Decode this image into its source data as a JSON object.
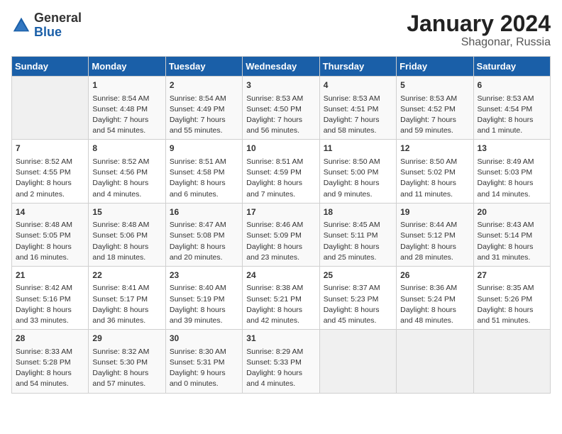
{
  "logo": {
    "general": "General",
    "blue": "Blue"
  },
  "header": {
    "month": "January 2024",
    "location": "Shagonar, Russia"
  },
  "days_of_week": [
    "Sunday",
    "Monday",
    "Tuesday",
    "Wednesday",
    "Thursday",
    "Friday",
    "Saturday"
  ],
  "weeks": [
    [
      {
        "day": "",
        "data": ""
      },
      {
        "day": "1",
        "data": "Sunrise: 8:54 AM\nSunset: 4:48 PM\nDaylight: 7 hours\nand 54 minutes."
      },
      {
        "day": "2",
        "data": "Sunrise: 8:54 AM\nSunset: 4:49 PM\nDaylight: 7 hours\nand 55 minutes."
      },
      {
        "day": "3",
        "data": "Sunrise: 8:53 AM\nSunset: 4:50 PM\nDaylight: 7 hours\nand 56 minutes."
      },
      {
        "day": "4",
        "data": "Sunrise: 8:53 AM\nSunset: 4:51 PM\nDaylight: 7 hours\nand 58 minutes."
      },
      {
        "day": "5",
        "data": "Sunrise: 8:53 AM\nSunset: 4:52 PM\nDaylight: 7 hours\nand 59 minutes."
      },
      {
        "day": "6",
        "data": "Sunrise: 8:53 AM\nSunset: 4:54 PM\nDaylight: 8 hours\nand 1 minute."
      }
    ],
    [
      {
        "day": "7",
        "data": "Sunrise: 8:52 AM\nSunset: 4:55 PM\nDaylight: 8 hours\nand 2 minutes."
      },
      {
        "day": "8",
        "data": "Sunrise: 8:52 AM\nSunset: 4:56 PM\nDaylight: 8 hours\nand 4 minutes."
      },
      {
        "day": "9",
        "data": "Sunrise: 8:51 AM\nSunset: 4:58 PM\nDaylight: 8 hours\nand 6 minutes."
      },
      {
        "day": "10",
        "data": "Sunrise: 8:51 AM\nSunset: 4:59 PM\nDaylight: 8 hours\nand 7 minutes."
      },
      {
        "day": "11",
        "data": "Sunrise: 8:50 AM\nSunset: 5:00 PM\nDaylight: 8 hours\nand 9 minutes."
      },
      {
        "day": "12",
        "data": "Sunrise: 8:50 AM\nSunset: 5:02 PM\nDaylight: 8 hours\nand 11 minutes."
      },
      {
        "day": "13",
        "data": "Sunrise: 8:49 AM\nSunset: 5:03 PM\nDaylight: 8 hours\nand 14 minutes."
      }
    ],
    [
      {
        "day": "14",
        "data": "Sunrise: 8:48 AM\nSunset: 5:05 PM\nDaylight: 8 hours\nand 16 minutes."
      },
      {
        "day": "15",
        "data": "Sunrise: 8:48 AM\nSunset: 5:06 PM\nDaylight: 8 hours\nand 18 minutes."
      },
      {
        "day": "16",
        "data": "Sunrise: 8:47 AM\nSunset: 5:08 PM\nDaylight: 8 hours\nand 20 minutes."
      },
      {
        "day": "17",
        "data": "Sunrise: 8:46 AM\nSunset: 5:09 PM\nDaylight: 8 hours\nand 23 minutes."
      },
      {
        "day": "18",
        "data": "Sunrise: 8:45 AM\nSunset: 5:11 PM\nDaylight: 8 hours\nand 25 minutes."
      },
      {
        "day": "19",
        "data": "Sunrise: 8:44 AM\nSunset: 5:12 PM\nDaylight: 8 hours\nand 28 minutes."
      },
      {
        "day": "20",
        "data": "Sunrise: 8:43 AM\nSunset: 5:14 PM\nDaylight: 8 hours\nand 31 minutes."
      }
    ],
    [
      {
        "day": "21",
        "data": "Sunrise: 8:42 AM\nSunset: 5:16 PM\nDaylight: 8 hours\nand 33 minutes."
      },
      {
        "day": "22",
        "data": "Sunrise: 8:41 AM\nSunset: 5:17 PM\nDaylight: 8 hours\nand 36 minutes."
      },
      {
        "day": "23",
        "data": "Sunrise: 8:40 AM\nSunset: 5:19 PM\nDaylight: 8 hours\nand 39 minutes."
      },
      {
        "day": "24",
        "data": "Sunrise: 8:38 AM\nSunset: 5:21 PM\nDaylight: 8 hours\nand 42 minutes."
      },
      {
        "day": "25",
        "data": "Sunrise: 8:37 AM\nSunset: 5:23 PM\nDaylight: 8 hours\nand 45 minutes."
      },
      {
        "day": "26",
        "data": "Sunrise: 8:36 AM\nSunset: 5:24 PM\nDaylight: 8 hours\nand 48 minutes."
      },
      {
        "day": "27",
        "data": "Sunrise: 8:35 AM\nSunset: 5:26 PM\nDaylight: 8 hours\nand 51 minutes."
      }
    ],
    [
      {
        "day": "28",
        "data": "Sunrise: 8:33 AM\nSunset: 5:28 PM\nDaylight: 8 hours\nand 54 minutes."
      },
      {
        "day": "29",
        "data": "Sunrise: 8:32 AM\nSunset: 5:30 PM\nDaylight: 8 hours\nand 57 minutes."
      },
      {
        "day": "30",
        "data": "Sunrise: 8:30 AM\nSunset: 5:31 PM\nDaylight: 9 hours\nand 0 minutes."
      },
      {
        "day": "31",
        "data": "Sunrise: 8:29 AM\nSunset: 5:33 PM\nDaylight: 9 hours\nand 4 minutes."
      },
      {
        "day": "",
        "data": ""
      },
      {
        "day": "",
        "data": ""
      },
      {
        "day": "",
        "data": ""
      }
    ]
  ]
}
